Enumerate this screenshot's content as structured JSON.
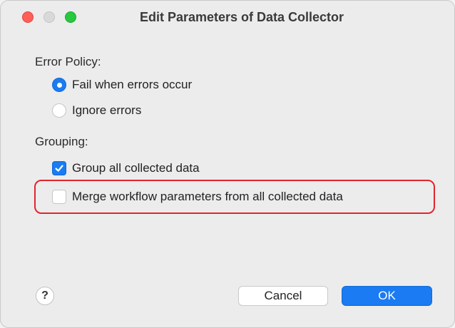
{
  "window": {
    "title": "Edit Parameters of Data Collector"
  },
  "error_policy": {
    "label": "Error Policy:",
    "options": [
      {
        "label": "Fail when errors occur",
        "selected": true
      },
      {
        "label": "Ignore errors",
        "selected": false
      }
    ]
  },
  "grouping": {
    "label": "Grouping:",
    "options": [
      {
        "label": "Group all collected data",
        "checked": true
      },
      {
        "label": "Merge workflow parameters from all collected data",
        "checked": false
      }
    ]
  },
  "footer": {
    "help_label": "?",
    "cancel_label": "Cancel",
    "ok_label": "OK"
  },
  "colors": {
    "accent": "#1a7bf2",
    "highlight": "#e0262e"
  }
}
